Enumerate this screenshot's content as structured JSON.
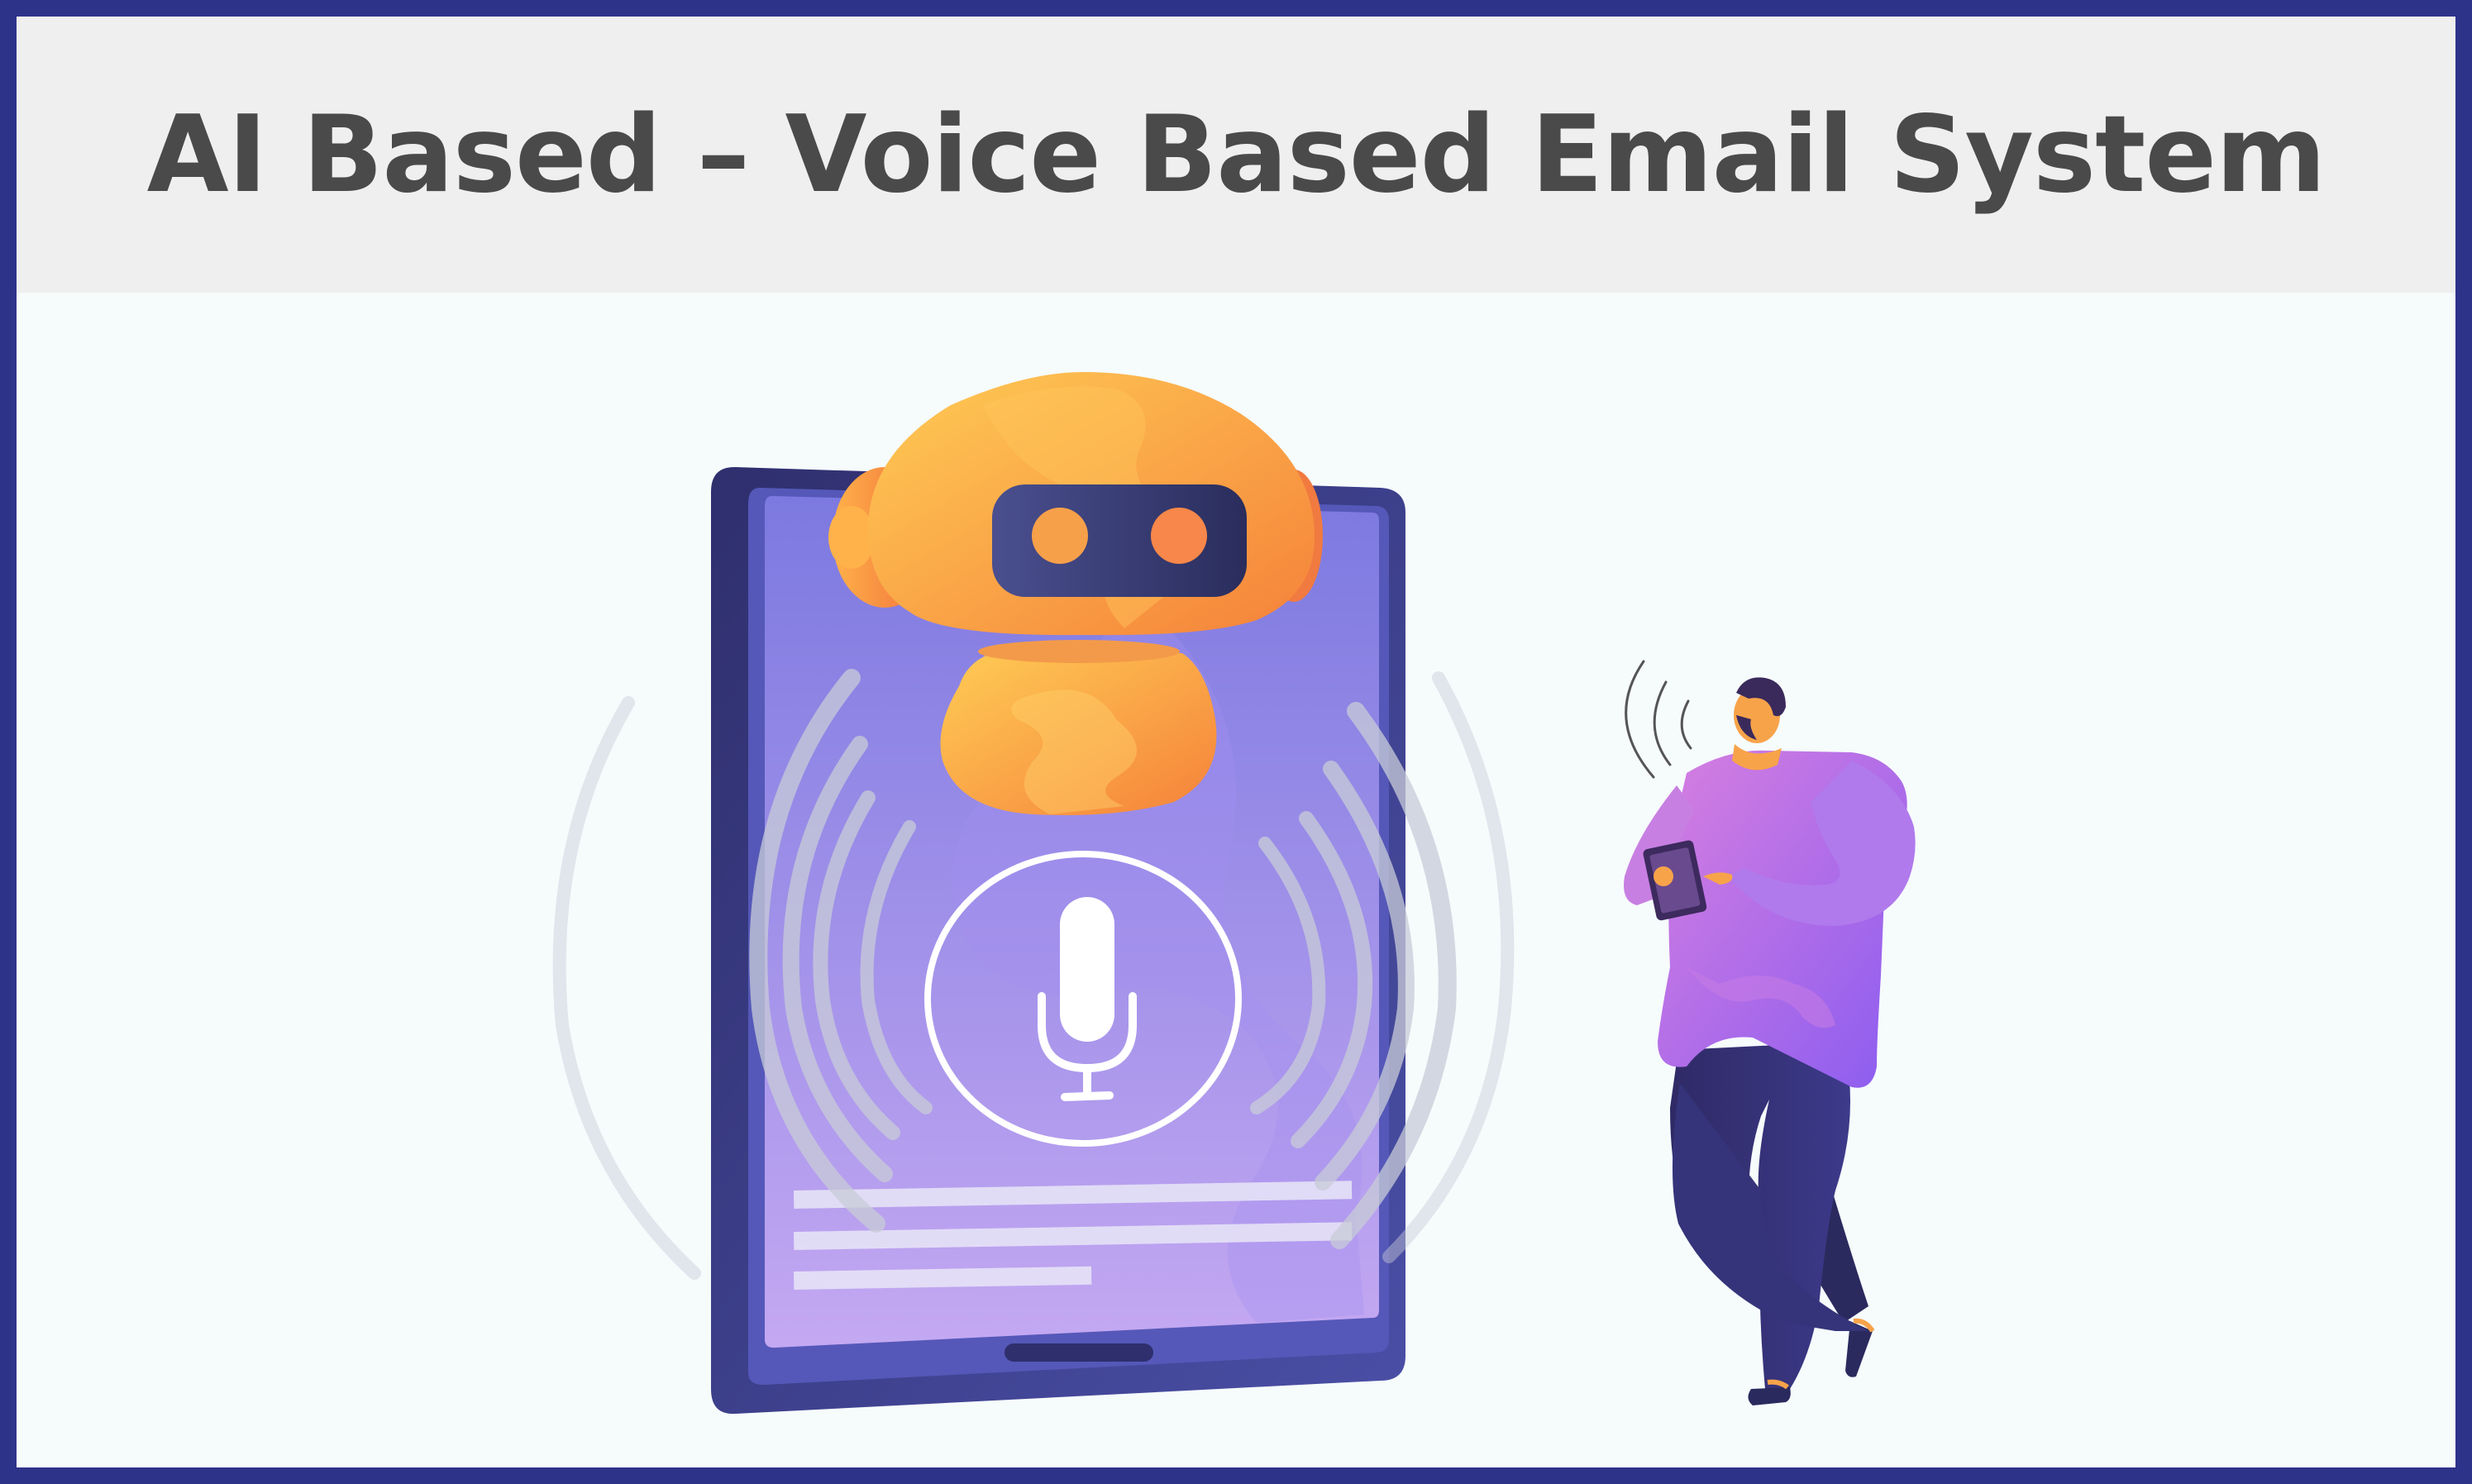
{
  "header": {
    "title": "AI Based – Voice Based Email System"
  },
  "colors": {
    "frame_border": "#2e338a",
    "title_bar_bg": "#efefef",
    "title_text": "#4a4a4a",
    "tablet_body": "#3d3f8c",
    "robot_orange": "#f7a347",
    "person_shirt": "#a070e8"
  },
  "icons": {
    "robot": "robot-icon",
    "microphone": "microphone-icon",
    "tablet": "tablet-icon",
    "person": "person-icon"
  }
}
